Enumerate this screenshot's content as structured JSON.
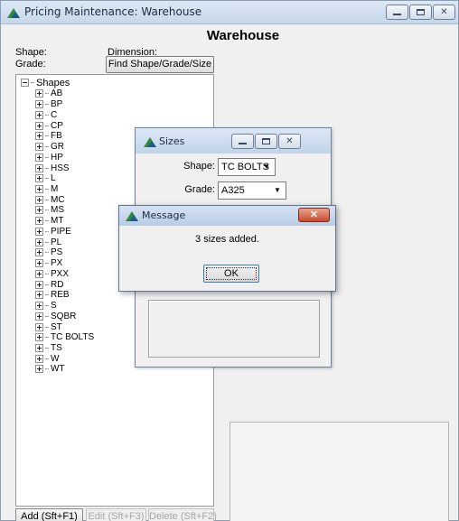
{
  "window": {
    "title": "Pricing Maintenance: Warehouse",
    "icon": "triangle-app-icon"
  },
  "header": {
    "title": "Warehouse"
  },
  "filters": {
    "shape_label": "Shape:",
    "grade_label": "Grade:",
    "dimension_label": "Dimension:",
    "find_button": "Find Shape/Grade/Size"
  },
  "tree": {
    "root": "Shapes",
    "items": [
      "AB",
      "BP",
      "C",
      "CP",
      "FB",
      "GR",
      "HP",
      "HSS",
      "L",
      "M",
      "MC",
      "MS",
      "MT",
      "PIPE",
      "PL",
      "PS",
      "PX",
      "PXX",
      "RD",
      "REB",
      "S",
      "SQBR",
      "ST",
      "TC BOLTS",
      "TS",
      "W",
      "WT"
    ]
  },
  "actions": {
    "add": "Add (Sft+F1)",
    "edit": "Edit (Sft+F3)",
    "delete": "Delete (Sft+F2)"
  },
  "sizes_dialog": {
    "title": "Sizes",
    "shape_label": "Shape:",
    "shape_value": "TC BOLTS",
    "grade_label": "Grade:",
    "grade_value": "A325"
  },
  "message_box": {
    "title": "Message",
    "text": "3 sizes added.",
    "ok_label": "OK"
  },
  "colors": {
    "title_bar": "#c7d7ea",
    "window_bg": "#f0f0f0",
    "close_button": "#c84a2c",
    "ok_focus_border": "#3c7fb1"
  }
}
